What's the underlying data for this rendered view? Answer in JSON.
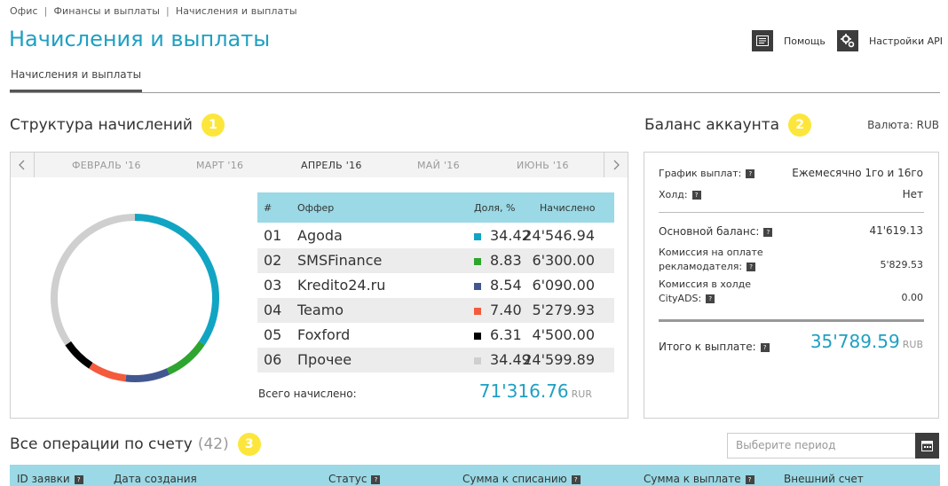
{
  "breadcrumb": [
    "Офис",
    "Финансы и выплаты",
    "Начисления и выплаты"
  ],
  "page_title": "Начисления и выплаты",
  "header_buttons": {
    "help": "Помощь",
    "api": "Настройки API"
  },
  "tabs": [
    {
      "label": "Начисления и выплаты",
      "active": true
    }
  ],
  "structure": {
    "title": "Структура начислений",
    "badge": "1",
    "months": [
      "ФЕВРАЛЬ '16",
      "МАРТ '16",
      "АПРЕЛЬ '16",
      "МАЙ '16",
      "ИЮНЬ '16"
    ],
    "active_month": "АПРЕЛЬ '16",
    "table_headers": {
      "num": "#",
      "offer": "Оффер",
      "share": "Доля, %",
      "accrued": "Начислено"
    },
    "rows": [
      {
        "num": "01",
        "offer": "Agoda",
        "share": "34.42",
        "accrued": "24'546.94",
        "color": "#11a5c3"
      },
      {
        "num": "02",
        "offer": "SMSFinance",
        "share": "8.83",
        "accrued": "6'300.00",
        "color": "#2ea52e"
      },
      {
        "num": "03",
        "offer": "Kredito24.ru",
        "share": "8.54",
        "accrued": "6'090.00",
        "color": "#42578f"
      },
      {
        "num": "04",
        "offer": "Teamo",
        "share": "7.40",
        "accrued": "5'279.93",
        "color": "#f45a3c"
      },
      {
        "num": "05",
        "offer": "Foxford",
        "share": "6.31",
        "accrued": "4'500.00",
        "color": "#000000"
      },
      {
        "num": "06",
        "offer": "Прочее",
        "share": "34.49",
        "accrued": "24'599.89",
        "color": "#cfcfcf"
      }
    ],
    "total_label": "Всего начислено:",
    "total_value": "71'316.76",
    "total_currency": "RUR"
  },
  "balance": {
    "title": "Баланс аккаунта",
    "badge": "2",
    "currency_label": "Валюта: RUB",
    "schedule_label": "График выплат:",
    "schedule_value": "Ежемесячно 1го и 16го",
    "hold_label": "Холд:",
    "hold_value": "Нет",
    "main_label": "Основной баланс:",
    "main_value": "41'619.13",
    "adv_fee_label_1": "Комиссия на оплате",
    "adv_fee_label_2": "рекламодателя:",
    "adv_fee_value": "5'829.53",
    "hold_fee_label_1": "Комиссия в холде",
    "hold_fee_label_2": "CityADS:",
    "hold_fee_value": "0.00",
    "total_label": "Итого к выплате:",
    "total_value": "35'789.59",
    "total_currency": "RUB"
  },
  "operations": {
    "title": "Все операции по счету",
    "count": "(42)",
    "badge": "3",
    "period_placeholder": "Выберите период",
    "columns": [
      "ID заявки",
      "Дата создания",
      "Статус",
      "Сумма к списанию",
      "Сумма к выплате",
      "Внешний счет"
    ]
  },
  "icons": {
    "help": "document-icon",
    "api": "gears-icon",
    "calendar": "calendar-icon",
    "help_marker": "question-icon"
  },
  "colors": {
    "accent": "#1fa0c2",
    "table_header": "#9ad9e5",
    "badge": "#fde63c"
  }
}
